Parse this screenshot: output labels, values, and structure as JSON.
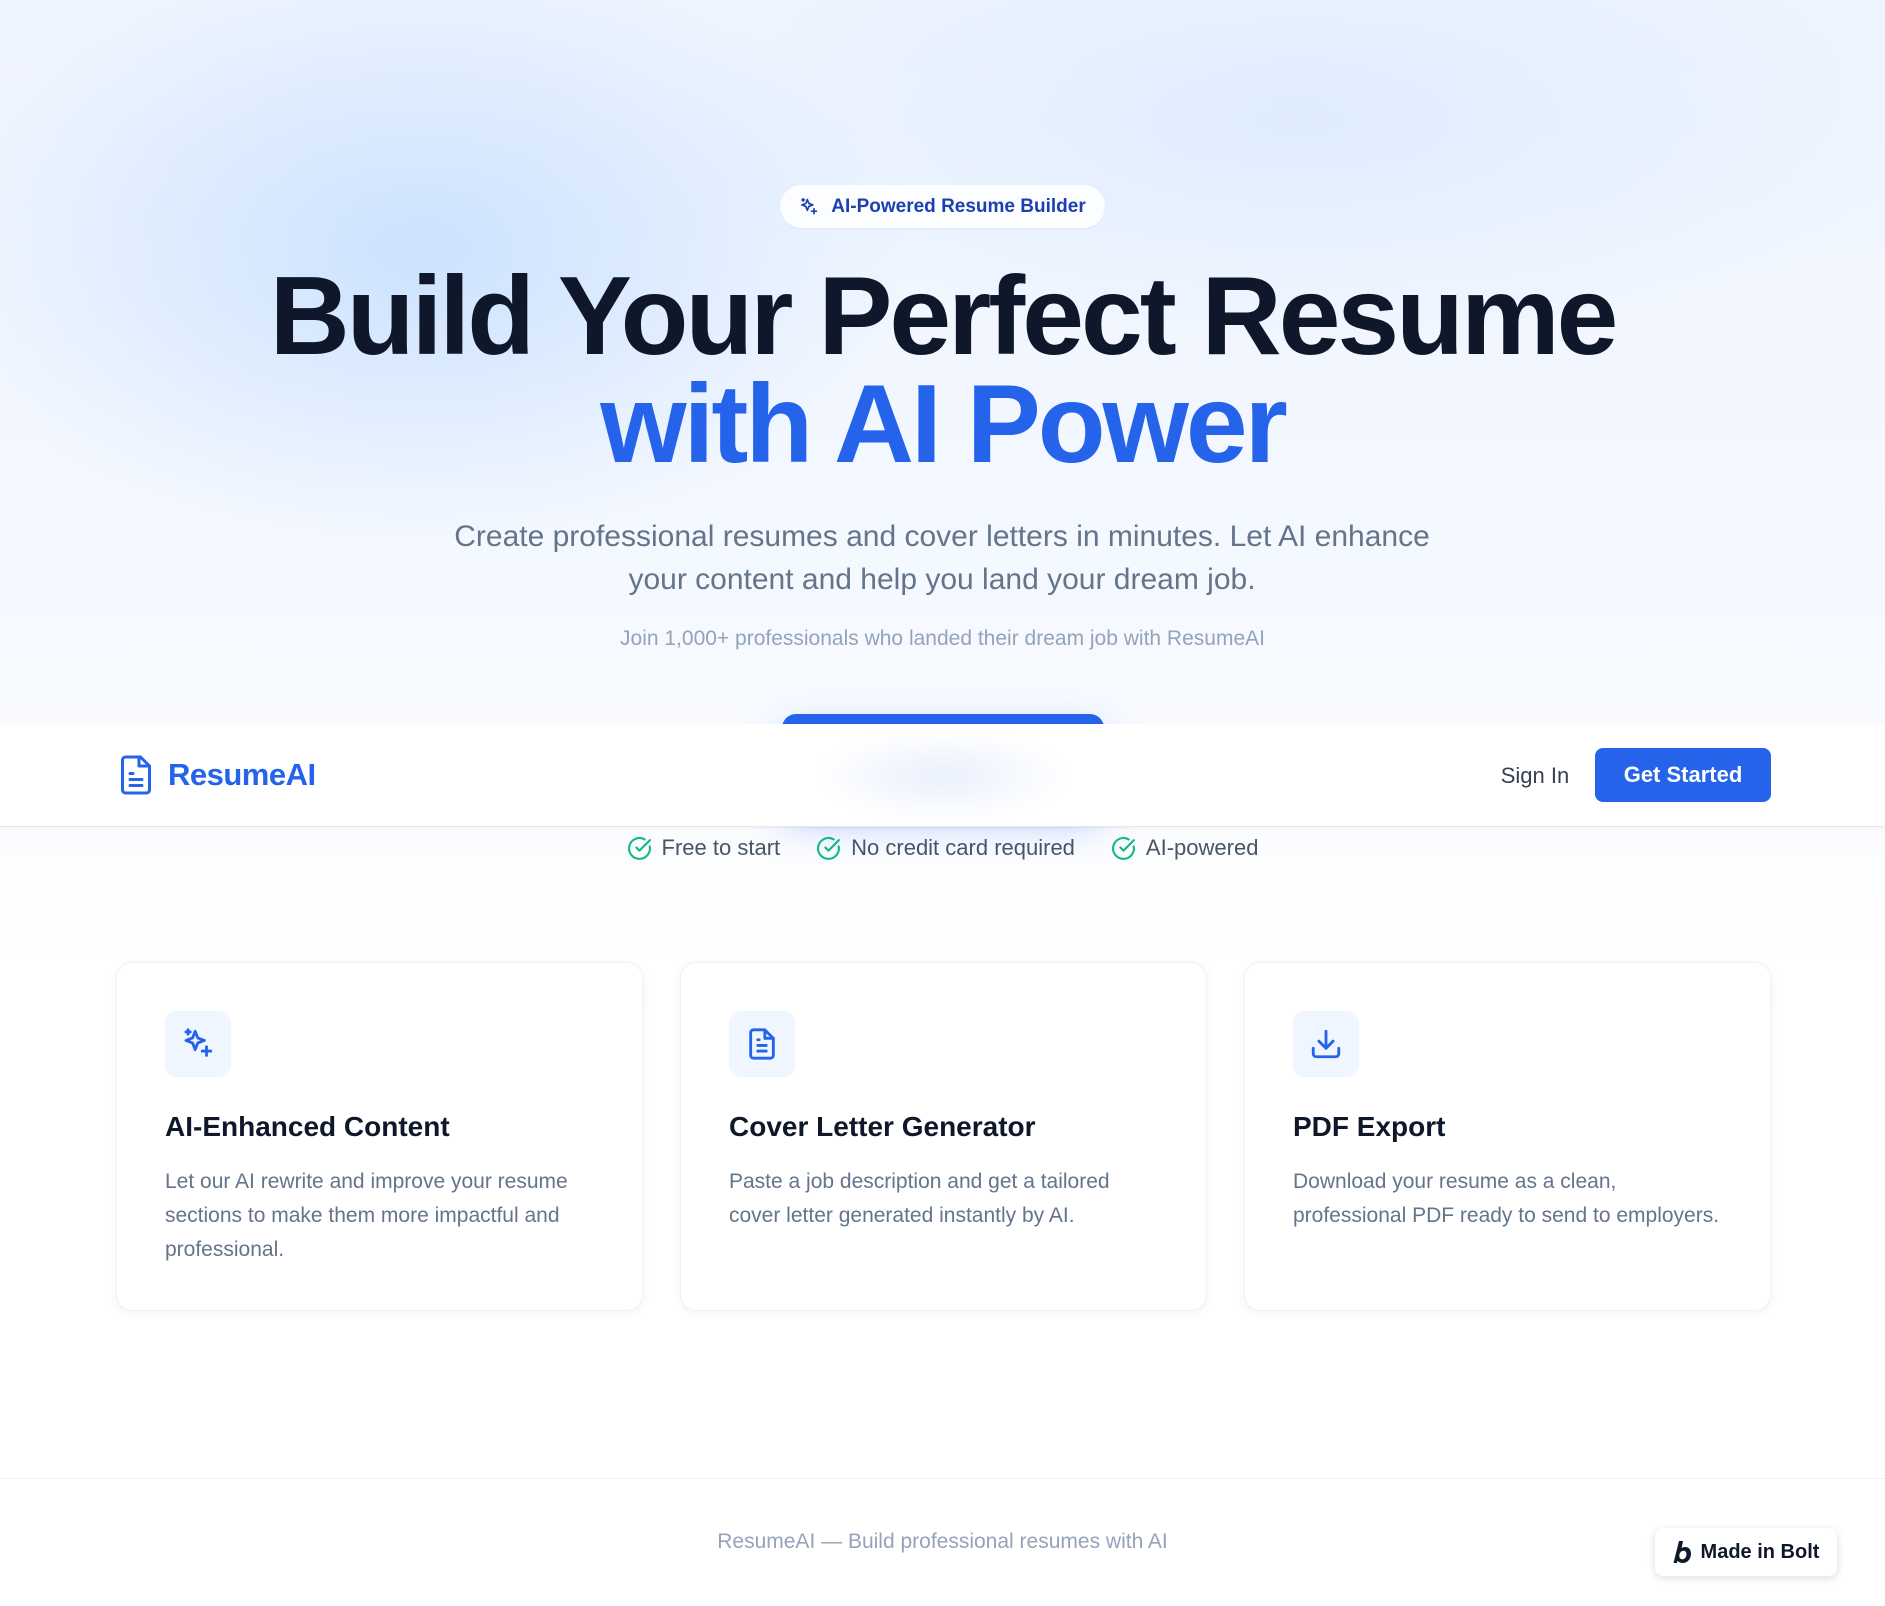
{
  "hero": {
    "badge": "AI-Powered Resume Builder",
    "headline_line1": "Build Your Perfect Resume",
    "headline_line2": "with AI Power",
    "subtitle": "Create professional resumes and cover letters in minutes. Let AI enhance your content and help you land your dream job.",
    "social_proof": "Join 1,000+ professionals who landed their dream job with ResumeAI",
    "checks": [
      "Free to start",
      "No credit card required",
      "AI-powered"
    ]
  },
  "navbar": {
    "brand": "ResumeAI",
    "sign_in": "Sign In",
    "get_started": "Get Started"
  },
  "features": [
    {
      "icon": "sparkles-icon",
      "title": "AI-Enhanced Content",
      "text": "Let our AI rewrite and improve your resume sections to make them more impactful and professional."
    },
    {
      "icon": "document-icon",
      "title": "Cover Letter Generator",
      "text": "Paste a job description and get a tailored cover letter generated instantly by AI."
    },
    {
      "icon": "download-icon",
      "title": "PDF Export",
      "text": "Download your resume as a clean, professional PDF ready to send to employers."
    }
  ],
  "footer": {
    "text": "ResumeAI — Build professional resumes with AI",
    "bolt_badge": "Made in Bolt"
  },
  "colors": {
    "primary": "#2563eb",
    "heading": "#0f172a",
    "muted": "#64748b",
    "check": "#10b981"
  }
}
